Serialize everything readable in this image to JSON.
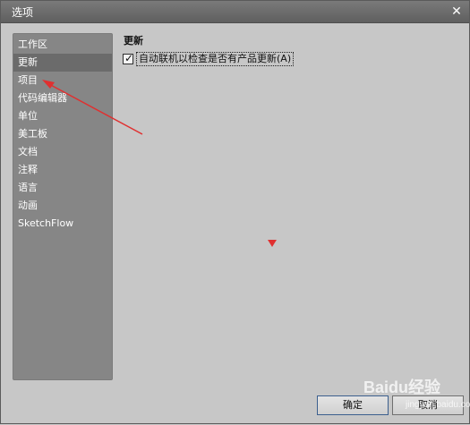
{
  "window": {
    "title": "选项"
  },
  "sidebar": {
    "items": [
      {
        "label": "工作区",
        "selected": false
      },
      {
        "label": "更新",
        "selected": true
      },
      {
        "label": "项目",
        "selected": false
      },
      {
        "label": "代码编辑器",
        "selected": false
      },
      {
        "label": "单位",
        "selected": false
      },
      {
        "label": "美工板",
        "selected": false
      },
      {
        "label": "文档",
        "selected": false
      },
      {
        "label": "注释",
        "selected": false
      },
      {
        "label": "语言",
        "selected": false
      },
      {
        "label": "动画",
        "selected": false
      },
      {
        "label": "SketchFlow",
        "selected": false
      }
    ]
  },
  "main": {
    "section_title": "更新",
    "check_update": {
      "checked": true,
      "label": "自动联机以检查是否有产品更新(A)"
    }
  },
  "buttons": {
    "ok_label": "确定",
    "cancel_label": "取消"
  },
  "watermark": {
    "text": "Baidu经验",
    "sub": "jingyan.baidu.com"
  },
  "colors": {
    "annotation_red": "#e03030",
    "sidebar_bg": "#868686",
    "selected_bg": "#6b6b6b"
  },
  "icons": {
    "close": "close-icon",
    "checkmark": "checkmark-icon"
  }
}
